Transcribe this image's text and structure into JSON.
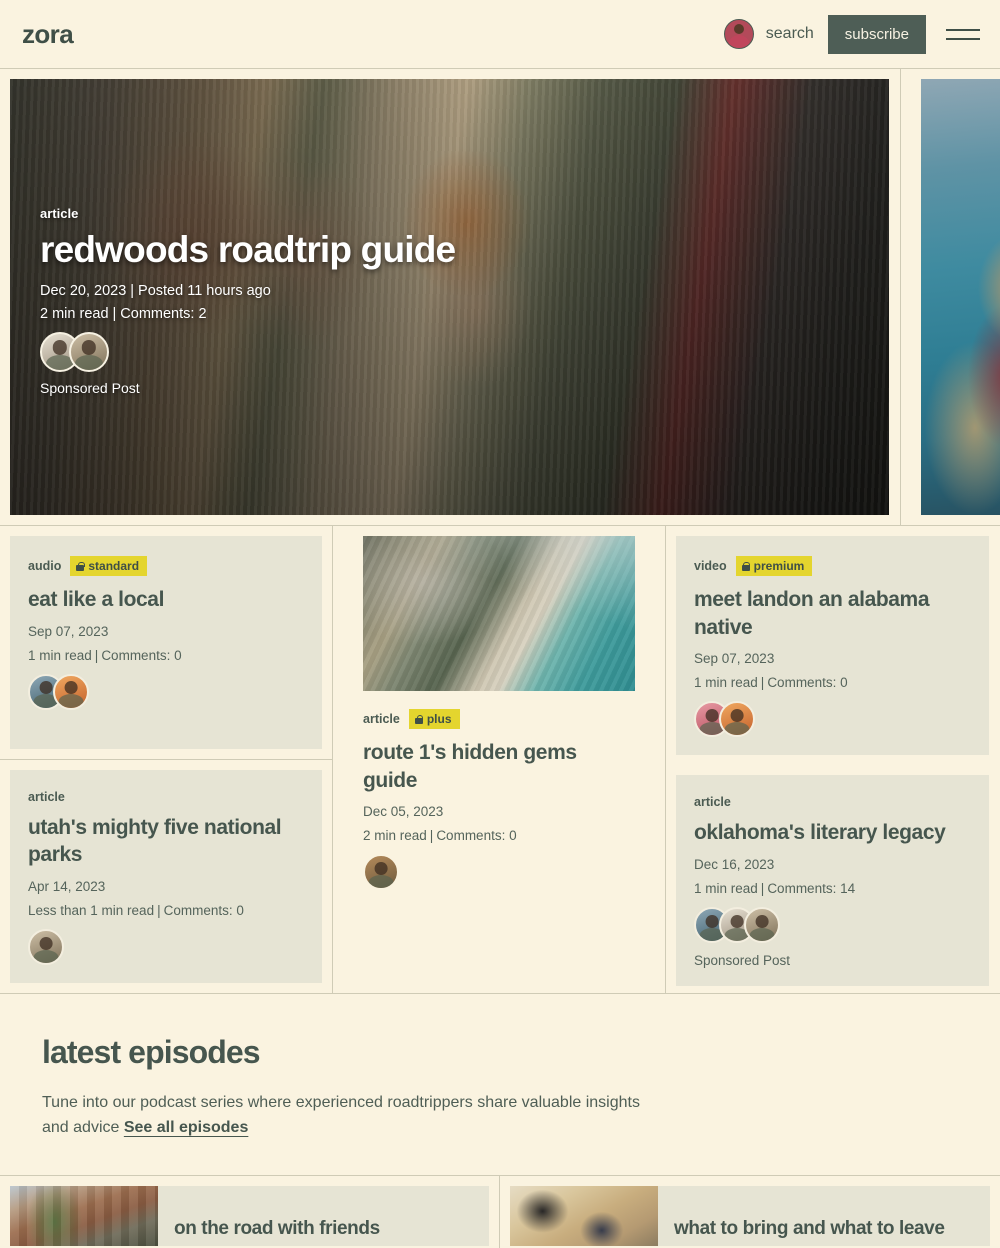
{
  "header": {
    "brand": "zora",
    "search_label": "search",
    "subscribe_label": "subscribe",
    "avatar_icon": "user-avatar-icon",
    "menu_icon": "hamburger-menu-icon"
  },
  "colors": {
    "page_bg": "#faf3e0",
    "card_bg": "#e6e4d4",
    "accent_dark": "#4e5e56",
    "badge_yellow": "#e4d52e",
    "text": "#46564e",
    "divider": "#cfcbb6"
  },
  "hero": {
    "kicker": "article",
    "title": "redwoods roadtrip guide",
    "date": "Dec 20, 2023",
    "posted": "Posted 11 hours ago",
    "read_time": "2 min read",
    "comments": "Comments: 2",
    "sponsored": "Sponsored Post",
    "separator": "|",
    "avatars": [
      "avatar-1",
      "avatar-2"
    ]
  },
  "cards": {
    "eat_like_a_local": {
      "tag": "audio",
      "badge": "standard",
      "title": "eat like a local",
      "date": "Sep 07, 2023",
      "read_time": "1 min read",
      "comments": "Comments: 0",
      "separator": "|"
    },
    "utah_parks": {
      "tag": "article",
      "title": "utah's mighty five national parks",
      "date": "Apr 14, 2023",
      "read_time": "Less than 1 min read",
      "comments": "Comments: 0",
      "separator": "|"
    },
    "route_1": {
      "tag": "article",
      "badge": "plus",
      "title": "route 1's hidden gems guide",
      "date": "Dec 05, 2023",
      "read_time": "2 min read",
      "comments": "Comments: 0",
      "separator": "|"
    },
    "meet_landon": {
      "tag": "video",
      "badge": "premium",
      "title": "meet landon an alabama native",
      "date": "Sep 07, 2023",
      "read_time": "1 min read",
      "comments": "Comments: 0",
      "separator": "|"
    },
    "oklahoma": {
      "tag": "article",
      "title": "oklahoma's literary legacy",
      "date": "Dec 16, 2023",
      "read_time": "1 min read",
      "comments": "Comments: 14",
      "sponsored": "Sponsored Post",
      "separator": "|"
    }
  },
  "episodes": {
    "section_title": "latest episodes",
    "description": "Tune into our podcast series where experienced roadtrippers share valuable insights and advice ",
    "see_all_label": "See all episodes",
    "items": [
      {
        "title": "on the road with friends",
        "thumb": "city-street-photo"
      },
      {
        "title": "what to bring and what to leave",
        "thumb": "travel-gear-photo"
      }
    ]
  }
}
